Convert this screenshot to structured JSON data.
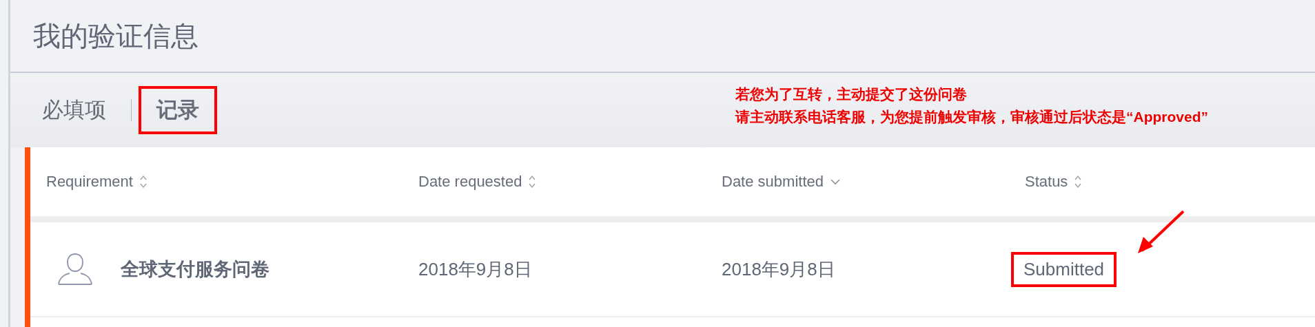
{
  "page_title": "我的验证信息",
  "tabs": [
    {
      "label": "必填项",
      "selected": false,
      "annotated": false
    },
    {
      "label": "记录",
      "selected": true,
      "annotated": true
    }
  ],
  "annotation": {
    "lines": [
      "若您为了互转，主动提交了这份问卷",
      "请主动联系电话客服，为您提前触发审核，审核通过后状态是“Approved”"
    ]
  },
  "table": {
    "columns": [
      {
        "label": "Requirement",
        "sorted": false
      },
      {
        "label": "Date requested",
        "sorted": false
      },
      {
        "label": "Date submitted",
        "sorted": true
      },
      {
        "label": "Status",
        "sorted": false
      }
    ],
    "rows": [
      {
        "requirement": "全球支付服务问卷",
        "date_requested": "2018年9月8日",
        "date_submitted": "2018年9月8日",
        "status": "Submitted",
        "status_annotated": true
      }
    ]
  }
}
